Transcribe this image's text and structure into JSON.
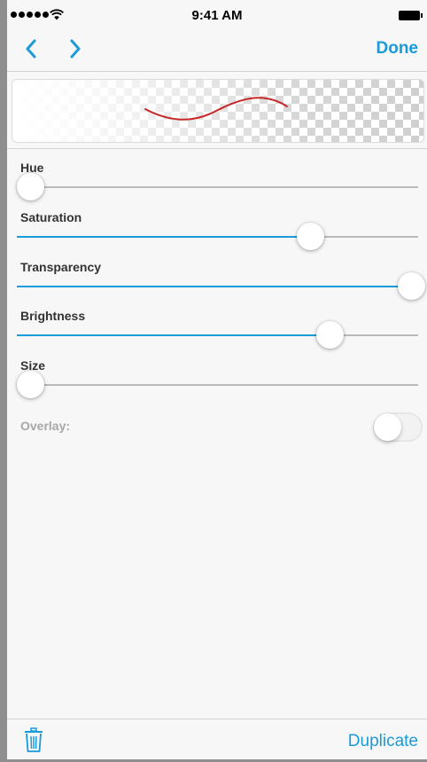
{
  "status_bar": {
    "time": "9:41 AM"
  },
  "nav": {
    "done_label": "Done"
  },
  "sliders": [
    {
      "label": "Hue",
      "value": 0.0
    },
    {
      "label": "Saturation",
      "value": 0.73
    },
    {
      "label": "Transparency",
      "value": 1.0
    },
    {
      "label": "Brightness",
      "value": 0.78
    },
    {
      "label": "Size",
      "value": 0.0
    }
  ],
  "overlay": {
    "label": "Overlay:",
    "enabled": false
  },
  "toolbar": {
    "duplicate_label": "Duplicate",
    "delete_icon": "trash-icon"
  },
  "colors": {
    "accent": "#1a9ad6",
    "stroke": "#c62828",
    "track": "#b9b9b9",
    "disabled_text": "#a7a7a7"
  }
}
